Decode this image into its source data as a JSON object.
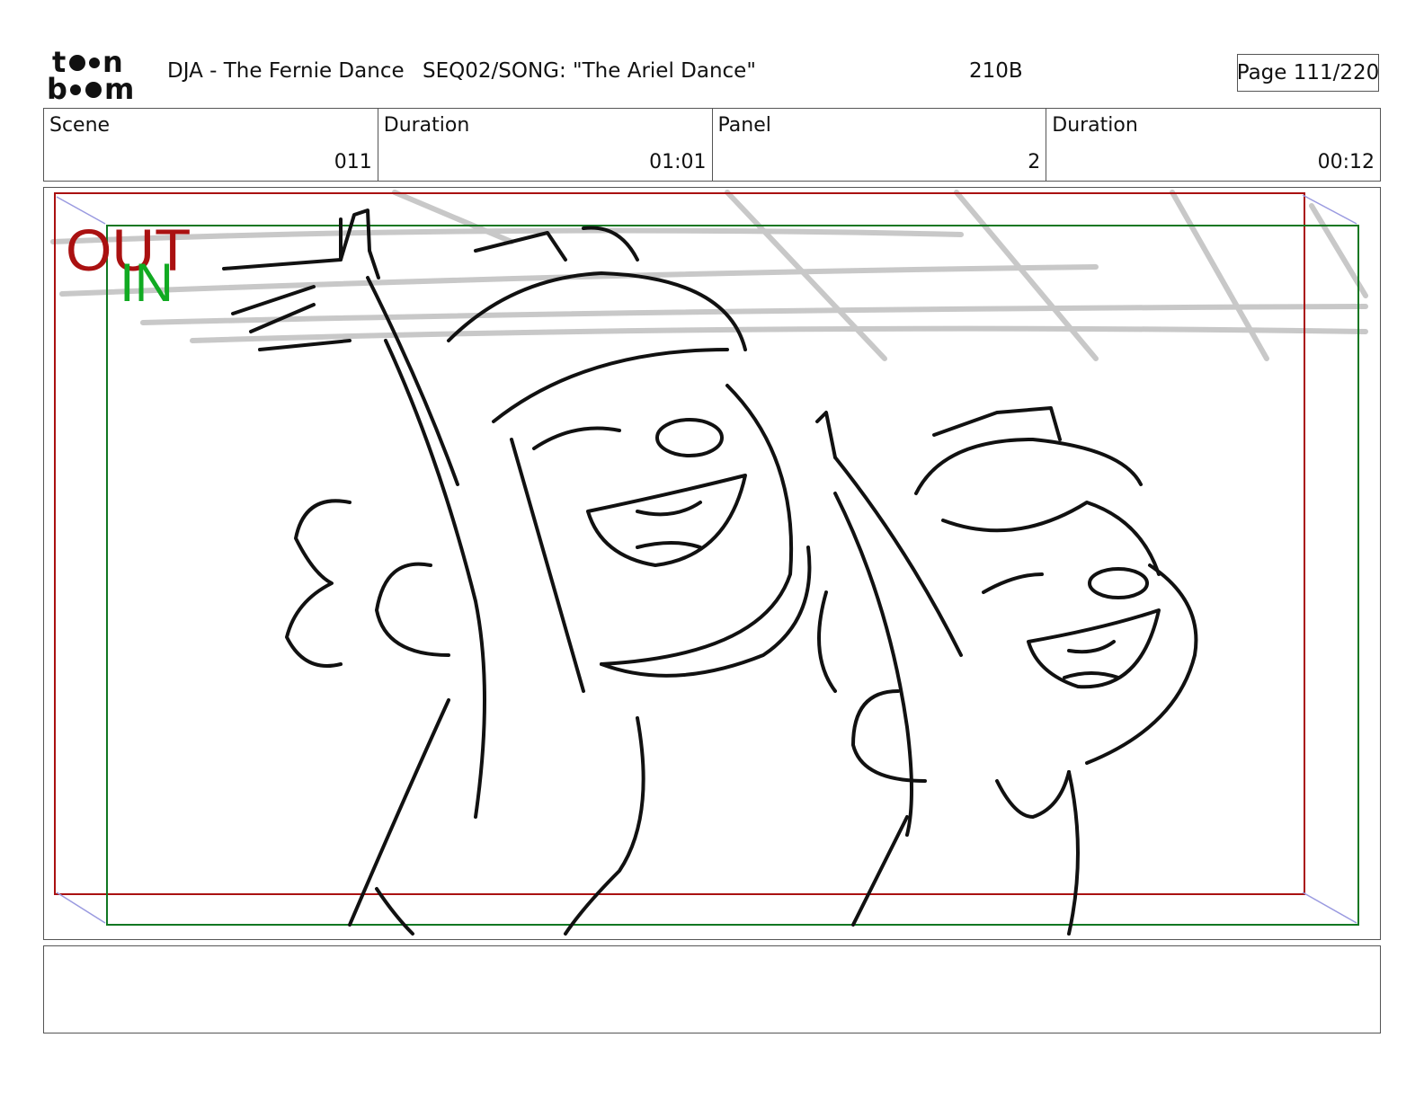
{
  "header": {
    "project_title": "DJA - The Fernie Dance",
    "sequence": "SEQ02/SONG: \"The Ariel Dance\"",
    "shot_code": "210B",
    "page": "Page 111/220"
  },
  "info": {
    "scene_label": "Scene",
    "scene_value": "011",
    "scene_duration_label": "Duration",
    "scene_duration_value": "01:01",
    "panel_label": "Panel",
    "panel_value": "2",
    "panel_duration_label": "Duration",
    "panel_duration_value": "00:12"
  },
  "panel": {
    "out_label": "OUT",
    "in_label": "IN",
    "out_color": "#aa1111",
    "in_color": "#11aa22"
  },
  "notes": {
    "text": ""
  },
  "logo": {
    "text": "toon boom"
  }
}
